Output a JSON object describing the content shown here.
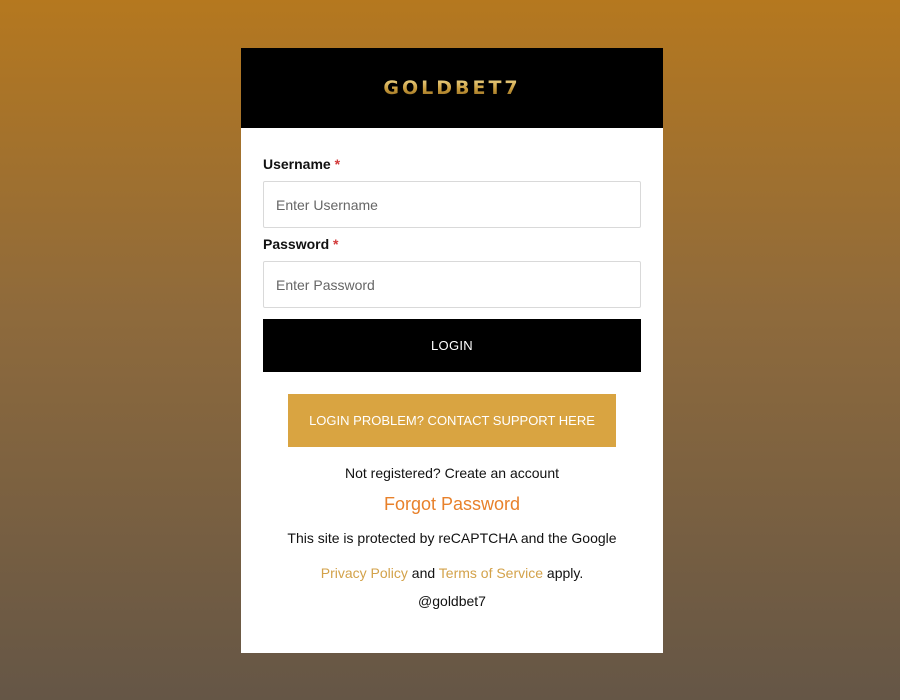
{
  "brand": {
    "logo_text": "GOLDBET7"
  },
  "form": {
    "username": {
      "label": "Username",
      "required_mark": "*",
      "placeholder": "Enter Username",
      "value": ""
    },
    "password": {
      "label": "Password",
      "required_mark": "*",
      "placeholder": "Enter Password",
      "value": ""
    },
    "login_label": "LOGIN",
    "support_label": "LOGIN PROBLEM? CONTACT SUPPORT HERE"
  },
  "links": {
    "register_text": "Not registered? Create an account",
    "forgot_password": "Forgot Password"
  },
  "recaptcha": {
    "prefix": "This site is protected by reCAPTCHA and the Google",
    "privacy_policy": "Privacy Policy",
    "and": "and",
    "terms_of_service": "Terms of Service",
    "suffix": "apply."
  },
  "footer": {
    "handle": "@goldbet7"
  },
  "colors": {
    "accent_gold": "#d9a441",
    "link_orange": "#e8812b",
    "link_gold": "#d3a24a",
    "header_black": "#000000",
    "required_red": "#d23a3a"
  }
}
